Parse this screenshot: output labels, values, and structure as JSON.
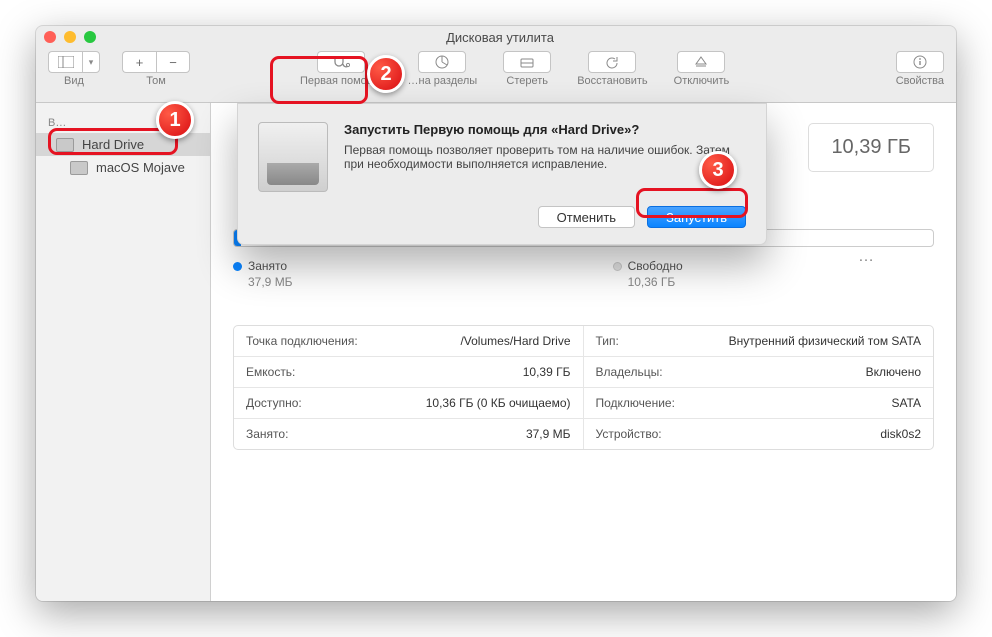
{
  "window_title": "Дисковая утилита",
  "toolbar": {
    "view": "Вид",
    "volume": "Том",
    "first_aid": "Первая помощь",
    "partition": "…на разделы",
    "erase": "Стереть",
    "restore": "Восстановить",
    "unmount": "Отключить",
    "info": "Свойства"
  },
  "sidebar": {
    "header": "В…",
    "items": [
      {
        "label": "Hard Drive",
        "selected": true
      },
      {
        "label": "macOS Mojave",
        "selected": false
      }
    ]
  },
  "main": {
    "capacity": "10,39 ГБ",
    "used_label": "Занято",
    "used_value": "37,9 МБ",
    "free_label": "Свободно",
    "free_value": "10,36 ГБ"
  },
  "info": [
    {
      "k": "Точка подключения:",
      "v": "/Volumes/Hard Drive"
    },
    {
      "k": "Тип:",
      "v": "Внутренний физический том SATA"
    },
    {
      "k": "Емкость:",
      "v": "10,39 ГБ"
    },
    {
      "k": "Владельцы:",
      "v": "Включено"
    },
    {
      "k": "Доступно:",
      "v": "10,36 ГБ (0 КБ очищаемо)"
    },
    {
      "k": "Подключение:",
      "v": "SATA"
    },
    {
      "k": "Занято:",
      "v": "37,9 МБ"
    },
    {
      "k": "Устройство:",
      "v": "disk0s2"
    }
  ],
  "dialog": {
    "title": "Запустить Первую помощь для «Hard Drive»?",
    "body": "Первая помощь позволяет проверить том на наличие ошибок. Затем при необходимости выполняется исправление.",
    "cancel": "Отменить",
    "run": "Запустить"
  },
  "annotations": {
    "n1": "1",
    "n2": "2",
    "n3": "3"
  }
}
